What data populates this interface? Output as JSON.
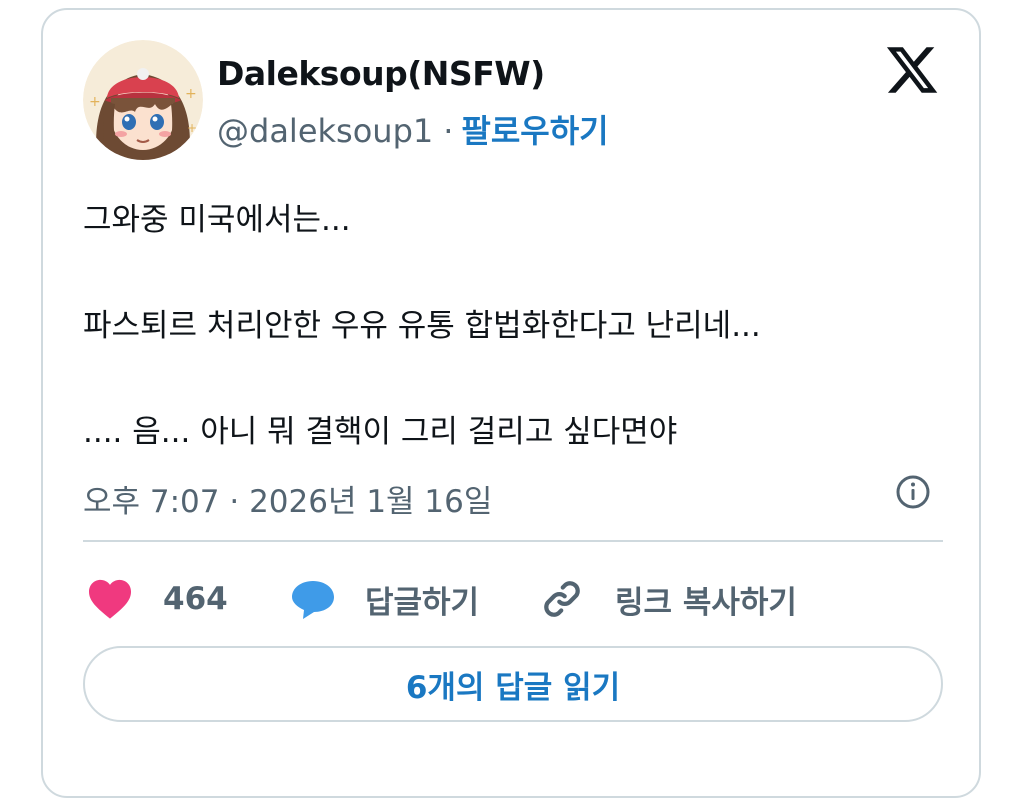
{
  "tweet": {
    "author": {
      "display_name": "Daleksoup(NSFW)",
      "handle": "@daleksoup1",
      "separator": "·",
      "follow_label": "팔로우하기"
    },
    "text_lines": [
      "그와중 미국에서는...",
      "파스퇴르 처리안한 우유 유통 합법화한다고 난리네...",
      ".... 음... 아니 뭐 결핵이 그리 걸리고 싶다면야"
    ],
    "timestamp": "오후 7:07 · 2026년 1월 16일",
    "actions": {
      "like_count": "464",
      "reply_label": "답글하기",
      "copy_link_label": "링크 복사하기"
    },
    "read_replies_label": "6개의 답글 읽기"
  },
  "icons": {
    "platform_logo": "x-logo-icon",
    "info": "info-icon",
    "like": "heart-icon",
    "reply": "speech-bubble-icon",
    "copy_link": "link-icon"
  },
  "colors": {
    "accent_blue": "#1a78c2",
    "heart": "#f0397f",
    "reply_bubble": "#3f9be8",
    "secondary_text": "#536471",
    "border": "#cfd9de"
  }
}
